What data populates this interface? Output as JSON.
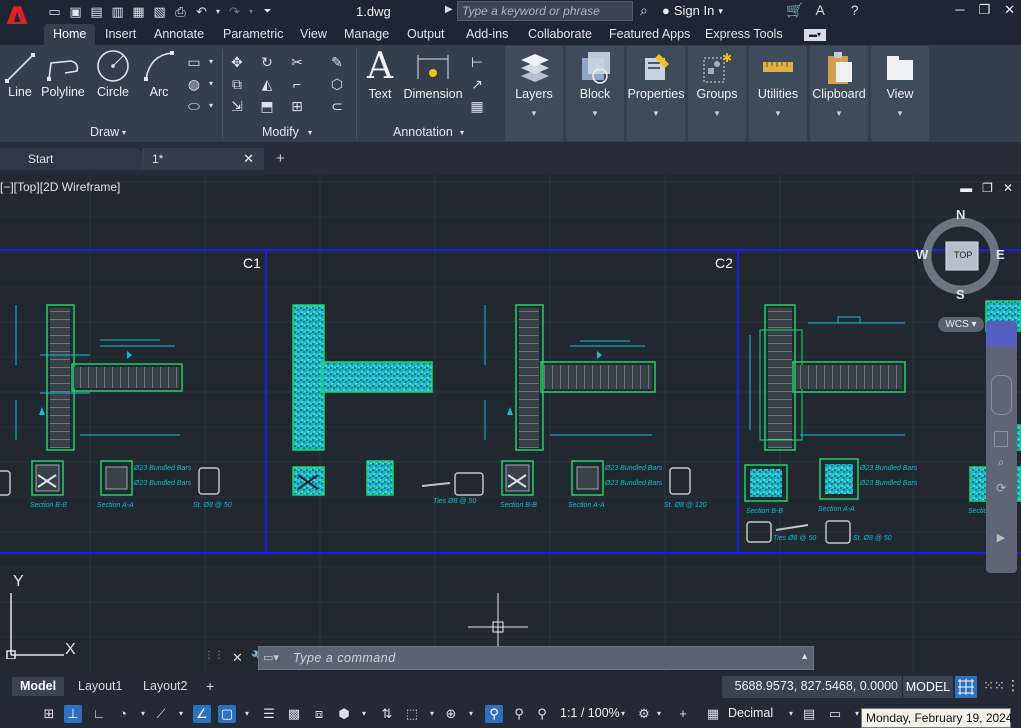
{
  "titlebar": {
    "document_title": "1.dwg",
    "search_placeholder": "Type a keyword or phrase",
    "signin_label": "Sign In"
  },
  "ribbon": {
    "tabs": [
      "Home",
      "Insert",
      "Annotate",
      "Parametric",
      "View",
      "Manage",
      "Output",
      "Add-ins",
      "Collaborate",
      "Featured Apps",
      "Express Tools"
    ],
    "active_tab": "Home",
    "draw_tools": [
      "Line",
      "Polyline",
      "Circle",
      "Arc"
    ],
    "annotation_tools": [
      "Text",
      "Dimension"
    ],
    "panels": [
      "Draw",
      "Modify",
      "Annotation"
    ],
    "groups": [
      "Layers",
      "Block",
      "Properties",
      "Groups",
      "Utilities",
      "Clipboard",
      "View"
    ]
  },
  "file_tabs": {
    "start_label": "Start",
    "doc_label": "1*"
  },
  "viewport": {
    "label": "[−][Top][2D Wireframe]",
    "column_labels": [
      "C1",
      "C2"
    ],
    "viewcube": {
      "top": "TOP",
      "n": "N",
      "s": "S",
      "e": "E",
      "w": "W",
      "wcs": "WCS"
    },
    "ucs": {
      "x": "X",
      "y": "Y"
    },
    "captions": {
      "sec_bb": "Section B-B",
      "sec_aa": "Section A-A",
      "bundled_1": "Ø23 Bundled Bars",
      "bundled_2": "Ø23 Bundled Bars",
      "st_50": "St. Ø8 @ 50",
      "st_120": "St. Ø8 @ 120",
      "ties": "Ties Ø8 @ 50",
      "ties2": "Ties Ø8 @ 50",
      "st2": "St. Ø8 @ 50",
      "sec_bb2": "Section B-B",
      "sec_aa2": "Section A-A",
      "sec_bb3": "Section B-B",
      "bundled_3": "Ø23 Bundled Bars",
      "bundled_4": "Ø23 Bundled Bars",
      "bundled_5": "Ø23 Bundled Bars",
      "bundled_6": "Ø23 Bundled Bars"
    }
  },
  "command": {
    "placeholder": "Type a command"
  },
  "layout": {
    "tabs": [
      "Model",
      "Layout1",
      "Layout2"
    ],
    "active": "Model",
    "coordinates": "5688.9573, 827.5468, 0.0000",
    "space": "MODEL"
  },
  "status": {
    "scale": "1:1 / 100%",
    "units": "Decimal",
    "date_tooltip": "Monday, February 19, 2024"
  },
  "colors": {
    "frame_blue": "#1b1ee6",
    "rebar_green": "#1fd26a",
    "cyan": "#0fbcd2",
    "ribbon": "#353e4c"
  }
}
